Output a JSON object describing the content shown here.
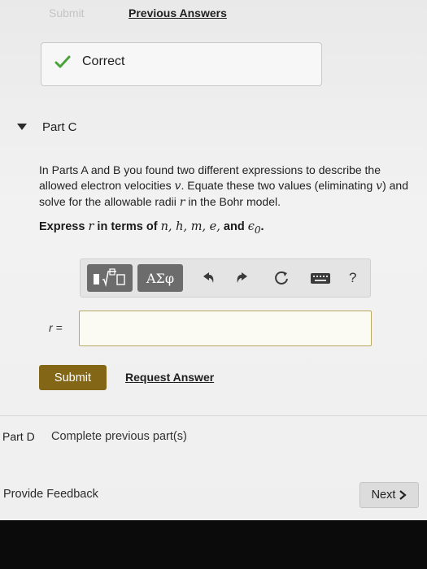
{
  "header": {
    "submit_faded": "Submit",
    "previous_answers": "Previous Answers"
  },
  "feedback": {
    "status": "Correct",
    "icon": "check-icon",
    "color": "#4aa23a"
  },
  "part_c": {
    "title": "Part C",
    "problem": {
      "t1": "In Parts A and B you found two different expressions to describe the allowed electron velocities ",
      "v1": "v",
      "t2": ". Equate these two values (eliminating ",
      "v2": "v",
      "t3": ") and solve for the allowable radii ",
      "r": "r",
      "t4": " in the Bohr model."
    },
    "express": {
      "lead": "Express ",
      "r": "r",
      "mid": " in terms of ",
      "vars": "n, h, m, e,",
      "and": " and ",
      "eps": "ϵ",
      "eps_sub": "0",
      "end": "."
    },
    "toolbar": {
      "templates": "templates-icon",
      "symbols_label": "ΑΣφ",
      "undo": "undo-icon",
      "redo": "redo-icon",
      "reset": "reset-icon",
      "keyboard": "keyboard-icon",
      "help_label": "?"
    },
    "answer_label": "r =",
    "answer_value": "",
    "submit_label": "Submit",
    "request_answer_label": "Request Answer",
    "accent_color": "#836616"
  },
  "part_d": {
    "label": "Part D",
    "status": "Complete previous part(s)"
  },
  "footer": {
    "provide_feedback": "Provide Feedback",
    "next_label": "Next",
    "next_icon": "chevron-right-icon"
  }
}
